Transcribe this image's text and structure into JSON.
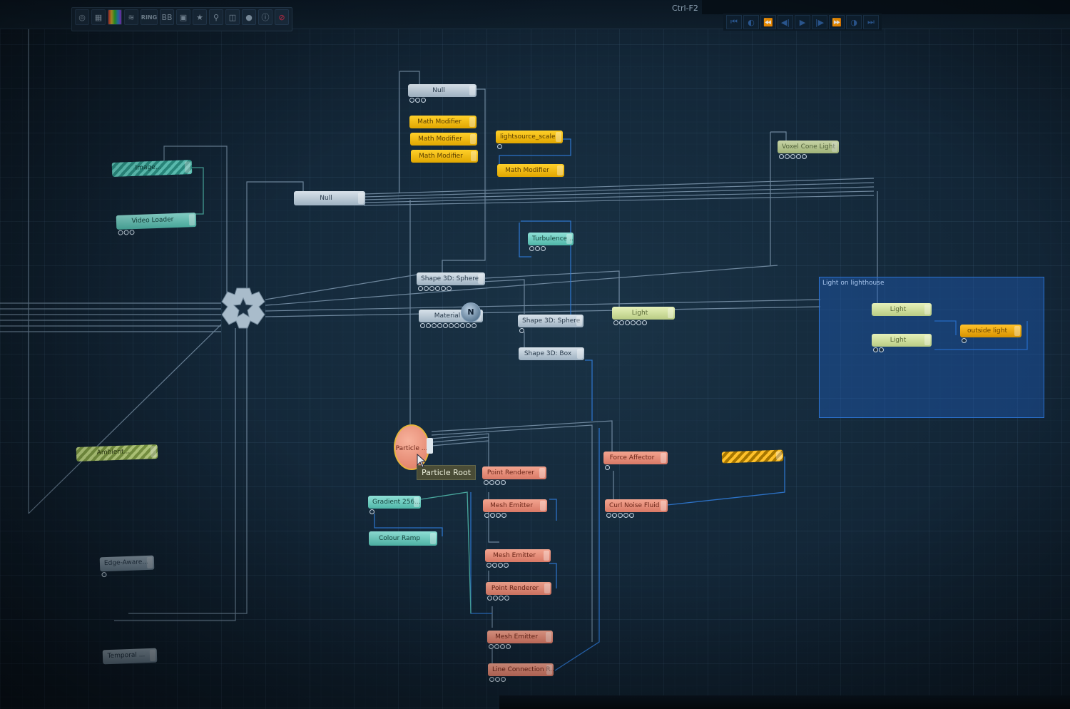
{
  "window": {
    "shortcut": "Ctrl-F2"
  },
  "toolbar": {
    "buttons": [
      {
        "name": "view-icon",
        "glyph": "◎"
      },
      {
        "name": "grid-icon",
        "glyph": "▦"
      },
      {
        "name": "colour-icon",
        "glyph": ""
      },
      {
        "name": "layers-icon",
        "glyph": "≋"
      },
      {
        "name": "ring-label",
        "glyph": "RING"
      },
      {
        "name": "bb-label",
        "glyph": "BB"
      },
      {
        "name": "frame-icon",
        "glyph": "▣"
      },
      {
        "name": "star-icon",
        "glyph": "★"
      },
      {
        "name": "magnify-icon",
        "glyph": "⚲"
      },
      {
        "name": "vr-icon",
        "glyph": "◫"
      },
      {
        "name": "sphere-icon",
        "glyph": "●"
      },
      {
        "name": "info-icon",
        "glyph": "ⓘ"
      },
      {
        "name": "stop-icon",
        "glyph": "⊘"
      }
    ]
  },
  "transport": {
    "buttons": [
      {
        "name": "go-start-icon",
        "glyph": "⏮"
      },
      {
        "name": "loop-icon",
        "glyph": "◐"
      },
      {
        "name": "rewind-icon",
        "glyph": "⏪"
      },
      {
        "name": "step-back-icon",
        "glyph": "◀|"
      },
      {
        "name": "play-icon",
        "glyph": "▶"
      },
      {
        "name": "step-forward-icon",
        "glyph": "|▶"
      },
      {
        "name": "fast-forward-icon",
        "glyph": "⏩"
      },
      {
        "name": "record-icon",
        "glyph": "◑"
      },
      {
        "name": "go-end-icon",
        "glyph": "⏭"
      }
    ]
  },
  "nodes": {
    "null_top": "Null",
    "math_modifier_1": "Math Modifier",
    "math_modifier_2": "Math Modifier",
    "math_modifier_3": "Math Modifier",
    "lightsource_scale": "lightsource_scale",
    "math_modifier_4": "Math Modifier",
    "voxel_cone_light": "Voxel Cone Light",
    "video_loader": "Video Loader",
    "null_mid": "Null",
    "turbulence": "Turbulence ...",
    "shape_sphere_1": "Shape 3D: Sphere",
    "material": "Material",
    "shape_sphere_2": "Shape 3D: Sphere",
    "shape_box": "Shape 3D: Box",
    "light_pale": "Light",
    "group_light_1": "Light",
    "group_light_2": "Light",
    "outside_light": "outside light",
    "particle": "Particle ...",
    "point_renderer_1": "Point Renderer",
    "force_affector": "Force Affector",
    "gradient": "Gradient 256...",
    "mesh_emitter_1": "Mesh Emitter",
    "curl_noise_fluid": "Curl Noise Fluid",
    "colour_ramp": "Colour Ramp",
    "mesh_emitter_2": "Mesh Emitter",
    "point_renderer_2": "Point Renderer",
    "mesh_emitter_3": "Mesh Emitter",
    "line_connection": "Line Connection R...",
    "edge_aware": "Edge-Aware...",
    "temporal": "Temporal ...",
    "hatched_top_left": "Image...",
    "hatched_ambient": "Ambient...",
    "hatched_gold": ""
  },
  "tooltip": {
    "text": "Particle Root"
  },
  "group": {
    "title": "Light on lighthouse"
  },
  "material_badge": "N",
  "colors": {
    "background": "#14293b",
    "wire": "#7d96ad",
    "wire_blue": "#2f7ad6",
    "group_fill": "#2060be",
    "node_grey": "#c0cdd8",
    "node_yellow": "#f5bd00",
    "node_salmon": "#ea917c",
    "node_pale": "#d3e2a2",
    "node_teal": "#6fcbbf"
  }
}
